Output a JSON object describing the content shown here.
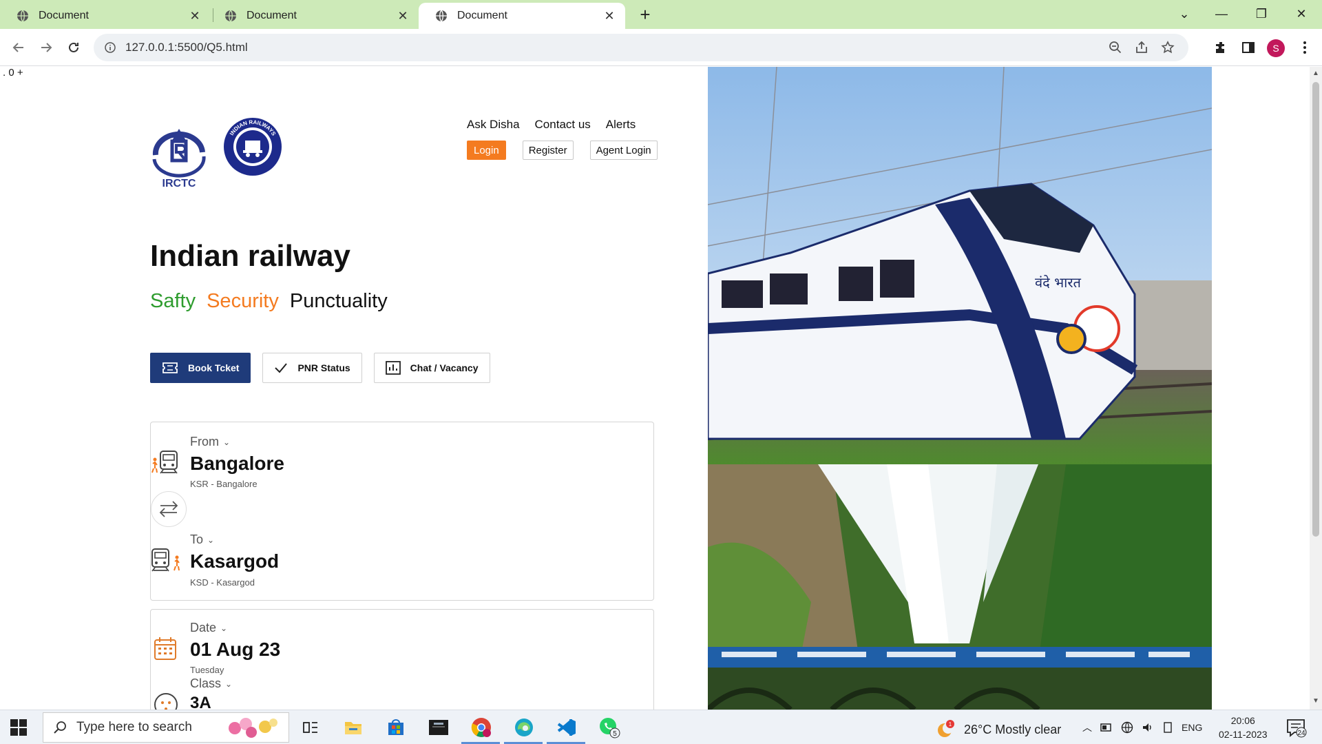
{
  "browser": {
    "tabs": [
      {
        "title": "Document",
        "active": false
      },
      {
        "title": "Document",
        "active": false
      },
      {
        "title": "Document",
        "active": true
      }
    ],
    "url": "127.0.0.1:5500/Q5.html",
    "profile_initial": "S",
    "accent": "#cdeab8"
  },
  "page": {
    "stray_text": ". 0 +",
    "logos": {
      "irctc_text": "IRCTC",
      "ir_ring_text": "INDIAN RAILWAYS"
    },
    "top_links": [
      "Ask Disha",
      "Contact us",
      "Alerts"
    ],
    "auth": {
      "login": "Login",
      "register": "Register",
      "agent_login": "Agent Login"
    },
    "title": "Indian railway",
    "tagline": {
      "one": "Safty",
      "two": "Security",
      "three": "Punctuality"
    },
    "actions": {
      "book": "Book Tcket",
      "pnr": "PNR Status",
      "chat": "Chat / Vacancy"
    },
    "from": {
      "label": "From",
      "value": "Bangalore",
      "sub": "KSR - Bangalore"
    },
    "to": {
      "label": "To",
      "value": "Kasargod",
      "sub": "KSD - Kasargod"
    },
    "date": {
      "label": "Date",
      "value": "01 Aug 23",
      "sub": "Tuesday"
    },
    "class": {
      "label": "Class",
      "value": "3A"
    },
    "train_logo_text": "वंदे भारत",
    "colors": {
      "primary": "#1f3b7a",
      "orange": "#f47b20",
      "green": "#2e9c2e"
    }
  },
  "taskbar": {
    "search_placeholder": "Type here to search",
    "weather": "26°C  Mostly clear",
    "weather_badge": "1",
    "lang": "ENG",
    "time": "20:06",
    "date": "02-11-2023",
    "notifications": "24",
    "whatsapp_badge": "5"
  }
}
